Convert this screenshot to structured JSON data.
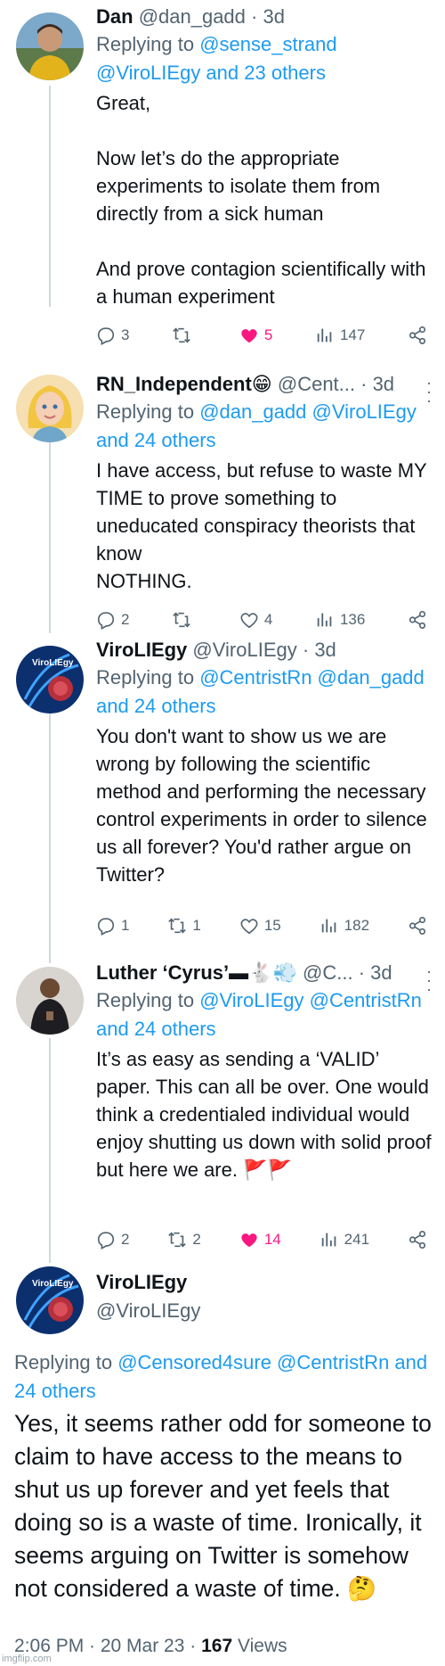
{
  "tweets": [
    {
      "name": "Dan",
      "handle": "@dan_gadd",
      "time": "· 3d",
      "reply_prefix": "Replying to ",
      "reply_mentions": "@sense_strand @ViroLIEgy and 23 others",
      "text": "Great,\n\nNow let’s do the appropriate experiments to isolate them from directly from a sick human\n\nAnd prove contagion scientifically with a human experiment",
      "replies": "3",
      "retweets": "",
      "likes": "5",
      "views": "147",
      "liked": true
    },
    {
      "name": "RN_Independent😁",
      "handle": "@Cent...",
      "time": "· 3d",
      "reply_prefix": "Replying to ",
      "reply_mentions": "@dan_gadd @ViroLIEgy and 24 others",
      "text": "I have access, but refuse to waste MY TIME to prove something to uneducated conspiracy theorists that know\nNOTHING.",
      "replies": "2",
      "retweets": "",
      "likes": "4",
      "views": "136",
      "liked": false
    },
    {
      "name": "ViroLIEgy",
      "handle": "@ViroLIEgy",
      "time": "· 3d",
      "reply_prefix": "Replying to ",
      "reply_mentions": "@CentristRn @dan_gadd and 24 others",
      "text": "You don't want to show us we are wrong by following the scientific method and performing the necessary control experiments in order to silence us all forever? You'd rather argue on Twitter?",
      "replies": "1",
      "retweets": "1",
      "likes": "15",
      "views": "182",
      "liked": false
    },
    {
      "name": "Luther ‘Cyrus’▬🐇💨",
      "handle": "@C...",
      "time": "· 3d",
      "reply_prefix": "Replying to ",
      "reply_mentions": "@ViroLIEgy @CentristRn and 24 others",
      "text": "It’s as easy as sending a ‘VALID’ paper. This can all be over. One would think a credentialed individual would enjoy shutting us down with solid proof but here we are. 🚩🚩",
      "replies": "2",
      "retweets": "2",
      "likes": "14",
      "views": "241",
      "liked": true
    }
  ],
  "main_tweet": {
    "name": "ViroLIEgy",
    "handle": "@ViroLIEgy",
    "reply_prefix": "Replying to ",
    "reply_mentions": "@Censored4sure @CentristRn and 24 others",
    "text": "Yes, it seems rather odd for someone to claim to have access to the means to shut us up forever and yet feels that doing so is a waste of time. Ironically, it seems arguing on Twitter is somehow not considered a waste of time. 🤔",
    "time_date": "2:06 PM · 20 Mar 23 · ",
    "views_count": "167",
    "views_label": " Views"
  },
  "watermark": "imgflip.com",
  "avatar_logo_text": "ViroLIEgy",
  "colors": {
    "accent": "#1d9bf0",
    "like": "#f91880",
    "muted": "#536471",
    "text": "#0f1419"
  }
}
